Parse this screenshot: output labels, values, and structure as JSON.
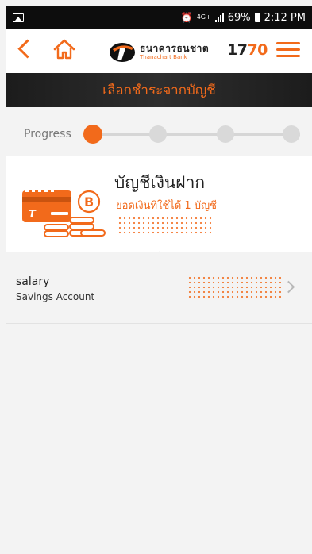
{
  "status_bar": {
    "network": "4G+",
    "battery": "69%",
    "time": "2:12 PM",
    "icons": [
      "image-icon",
      "alarm-icon",
      "signal-icon",
      "battery-icon"
    ]
  },
  "header": {
    "brand_thai": "ธนาคารธนชาต",
    "brand_en": "Thanachart Bank",
    "hotline_part1": "17",
    "hotline_part2": "70",
    "icons": [
      "back-icon",
      "home-icon",
      "thanachart-logo",
      "menu-icon"
    ]
  },
  "page_title": "เลือกชำระจากบัญชี",
  "progress": {
    "label": "Progress",
    "total_steps": 4,
    "current_step": 1
  },
  "account_summary": {
    "title": "บัญชีเงินฝาก",
    "subtitle": "ยอดเงินที่ใช้ได้ 1 บัญชี"
  },
  "accounts": [
    {
      "name": "salary",
      "type": "Savings Account"
    }
  ],
  "colors": {
    "accent": "#f26a1b",
    "title_bar": "#222222",
    "background": "#f3f3f3"
  }
}
